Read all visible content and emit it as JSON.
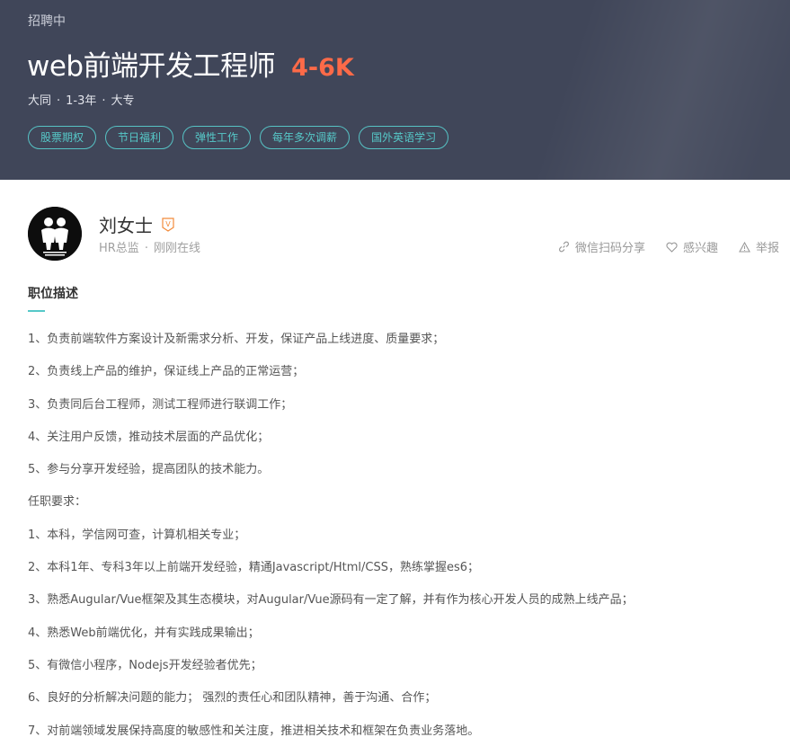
{
  "header": {
    "status": "招聘中",
    "title": "web前端开发工程师",
    "salary": "4-6K",
    "location": "大同",
    "experience": "1-3年",
    "education": "大专",
    "meta_separator": "·",
    "tags": [
      "股票期权",
      "节日福利",
      "弹性工作",
      "每年多次调薪",
      "国外英语学习"
    ]
  },
  "recruiter": {
    "name": "刘女士",
    "badge": "V",
    "title": "HR总监",
    "separator": "·",
    "online_status": "刚刚在线",
    "actions": {
      "share": "微信扫码分享",
      "interest": "感兴趣",
      "report": "举报"
    }
  },
  "description": {
    "heading": "职位描述",
    "lines": [
      "1、负责前端软件方案设计及新需求分析、开发，保证产品上线进度、质量要求；",
      "2、负责线上产品的维护，保证线上产品的正常运营；",
      "3、负责同后台工程师，测试工程师进行联调工作；",
      "4、关注用户反馈，推动技术层面的产品优化；",
      "5、参与分享开发经验，提高团队的技术能力。",
      "任职要求：",
      "1、本科，学信网可查，计算机相关专业；",
      "2、本科1年、专科3年以上前端开发经验，精通Javascript/Html/CSS，熟练掌握es6；",
      "3、熟悉Augular/Vue框架及其生态模块，对Augular/Vue源码有一定了解，并有作为核心开发人员的成熟上线产品；",
      "4、熟悉Web前端优化，并有实践成果输出；",
      "5、有微信小程序，Nodejs开发经验者优先；",
      "6、良好的分析解决问题的能力；  强烈的责任心和团队精神，善于沟通、合作；",
      "7、对前端领域发展保持高度的敏感性和关注度，推进相关技术和框架在负责业务落地。"
    ]
  },
  "colors": {
    "header_bg": "#404659",
    "salary": "#fd6a48",
    "accent": "#56c8c8",
    "badge": "#f28b3b"
  }
}
